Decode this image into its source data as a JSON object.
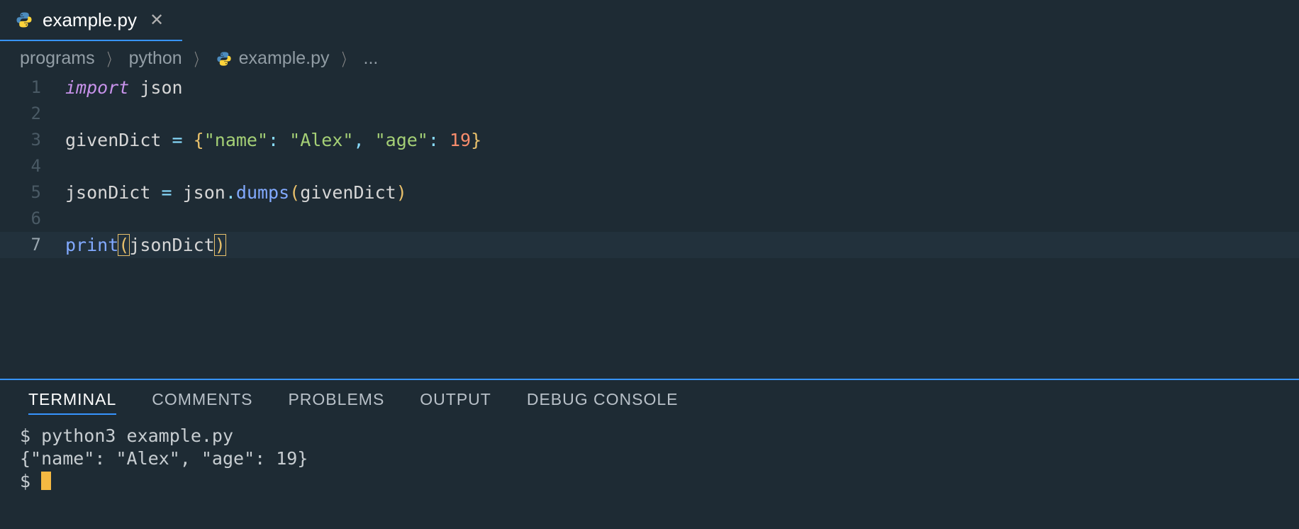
{
  "tab": {
    "label": "example.py",
    "icon": "python-icon"
  },
  "breadcrumbs": {
    "items": [
      "programs",
      "python"
    ],
    "file": "example.py",
    "trailing": "..."
  },
  "editor": {
    "lines": [
      {
        "num": "1",
        "current": false,
        "tokens": [
          {
            "t": "import",
            "c": "tok-keyword"
          },
          {
            "t": " ",
            "c": ""
          },
          {
            "t": "json",
            "c": "tok-module"
          }
        ]
      },
      {
        "num": "2",
        "current": false,
        "tokens": []
      },
      {
        "num": "3",
        "current": false,
        "tokens": [
          {
            "t": "givenDict",
            "c": "tok-var"
          },
          {
            "t": " ",
            "c": ""
          },
          {
            "t": "=",
            "c": "tok-op"
          },
          {
            "t": " ",
            "c": ""
          },
          {
            "t": "{",
            "c": "tok-brace"
          },
          {
            "t": "\"name\"",
            "c": "tok-string"
          },
          {
            "t": ":",
            "c": "tok-punct"
          },
          {
            "t": " ",
            "c": ""
          },
          {
            "t": "\"Alex\"",
            "c": "tok-string"
          },
          {
            "t": ",",
            "c": "tok-punct"
          },
          {
            "t": " ",
            "c": ""
          },
          {
            "t": "\"age\"",
            "c": "tok-string"
          },
          {
            "t": ":",
            "c": "tok-punct"
          },
          {
            "t": " ",
            "c": ""
          },
          {
            "t": "19",
            "c": "tok-number"
          },
          {
            "t": "}",
            "c": "tok-brace"
          }
        ]
      },
      {
        "num": "4",
        "current": false,
        "tokens": []
      },
      {
        "num": "5",
        "current": false,
        "tokens": [
          {
            "t": "jsonDict",
            "c": "tok-var"
          },
          {
            "t": " ",
            "c": ""
          },
          {
            "t": "=",
            "c": "tok-op"
          },
          {
            "t": " ",
            "c": ""
          },
          {
            "t": "json",
            "c": "tok-var"
          },
          {
            "t": ".",
            "c": "tok-punct"
          },
          {
            "t": "dumps",
            "c": "tok-member"
          },
          {
            "t": "(",
            "c": "tok-brace"
          },
          {
            "t": "givenDict",
            "c": "tok-var"
          },
          {
            "t": ")",
            "c": "tok-brace"
          }
        ]
      },
      {
        "num": "6",
        "current": false,
        "tokens": []
      },
      {
        "num": "7",
        "current": true,
        "tokens": [
          {
            "t": "print",
            "c": "tok-builtin"
          },
          {
            "t": "(",
            "c": "tok-brace-match"
          },
          {
            "t": "jsonDict",
            "c": "tok-var"
          },
          {
            "t": ")",
            "c": "tok-brace-match"
          }
        ]
      }
    ]
  },
  "panel": {
    "tabs": [
      "TERMINAL",
      "COMMENTS",
      "PROBLEMS",
      "OUTPUT",
      "DEBUG CONSOLE"
    ],
    "active": 0
  },
  "terminal": {
    "prompt": "$ ",
    "lines": [
      "$ python3 example.py",
      "{\"name\": \"Alex\", \"age\": 19}",
      "$ "
    ]
  }
}
